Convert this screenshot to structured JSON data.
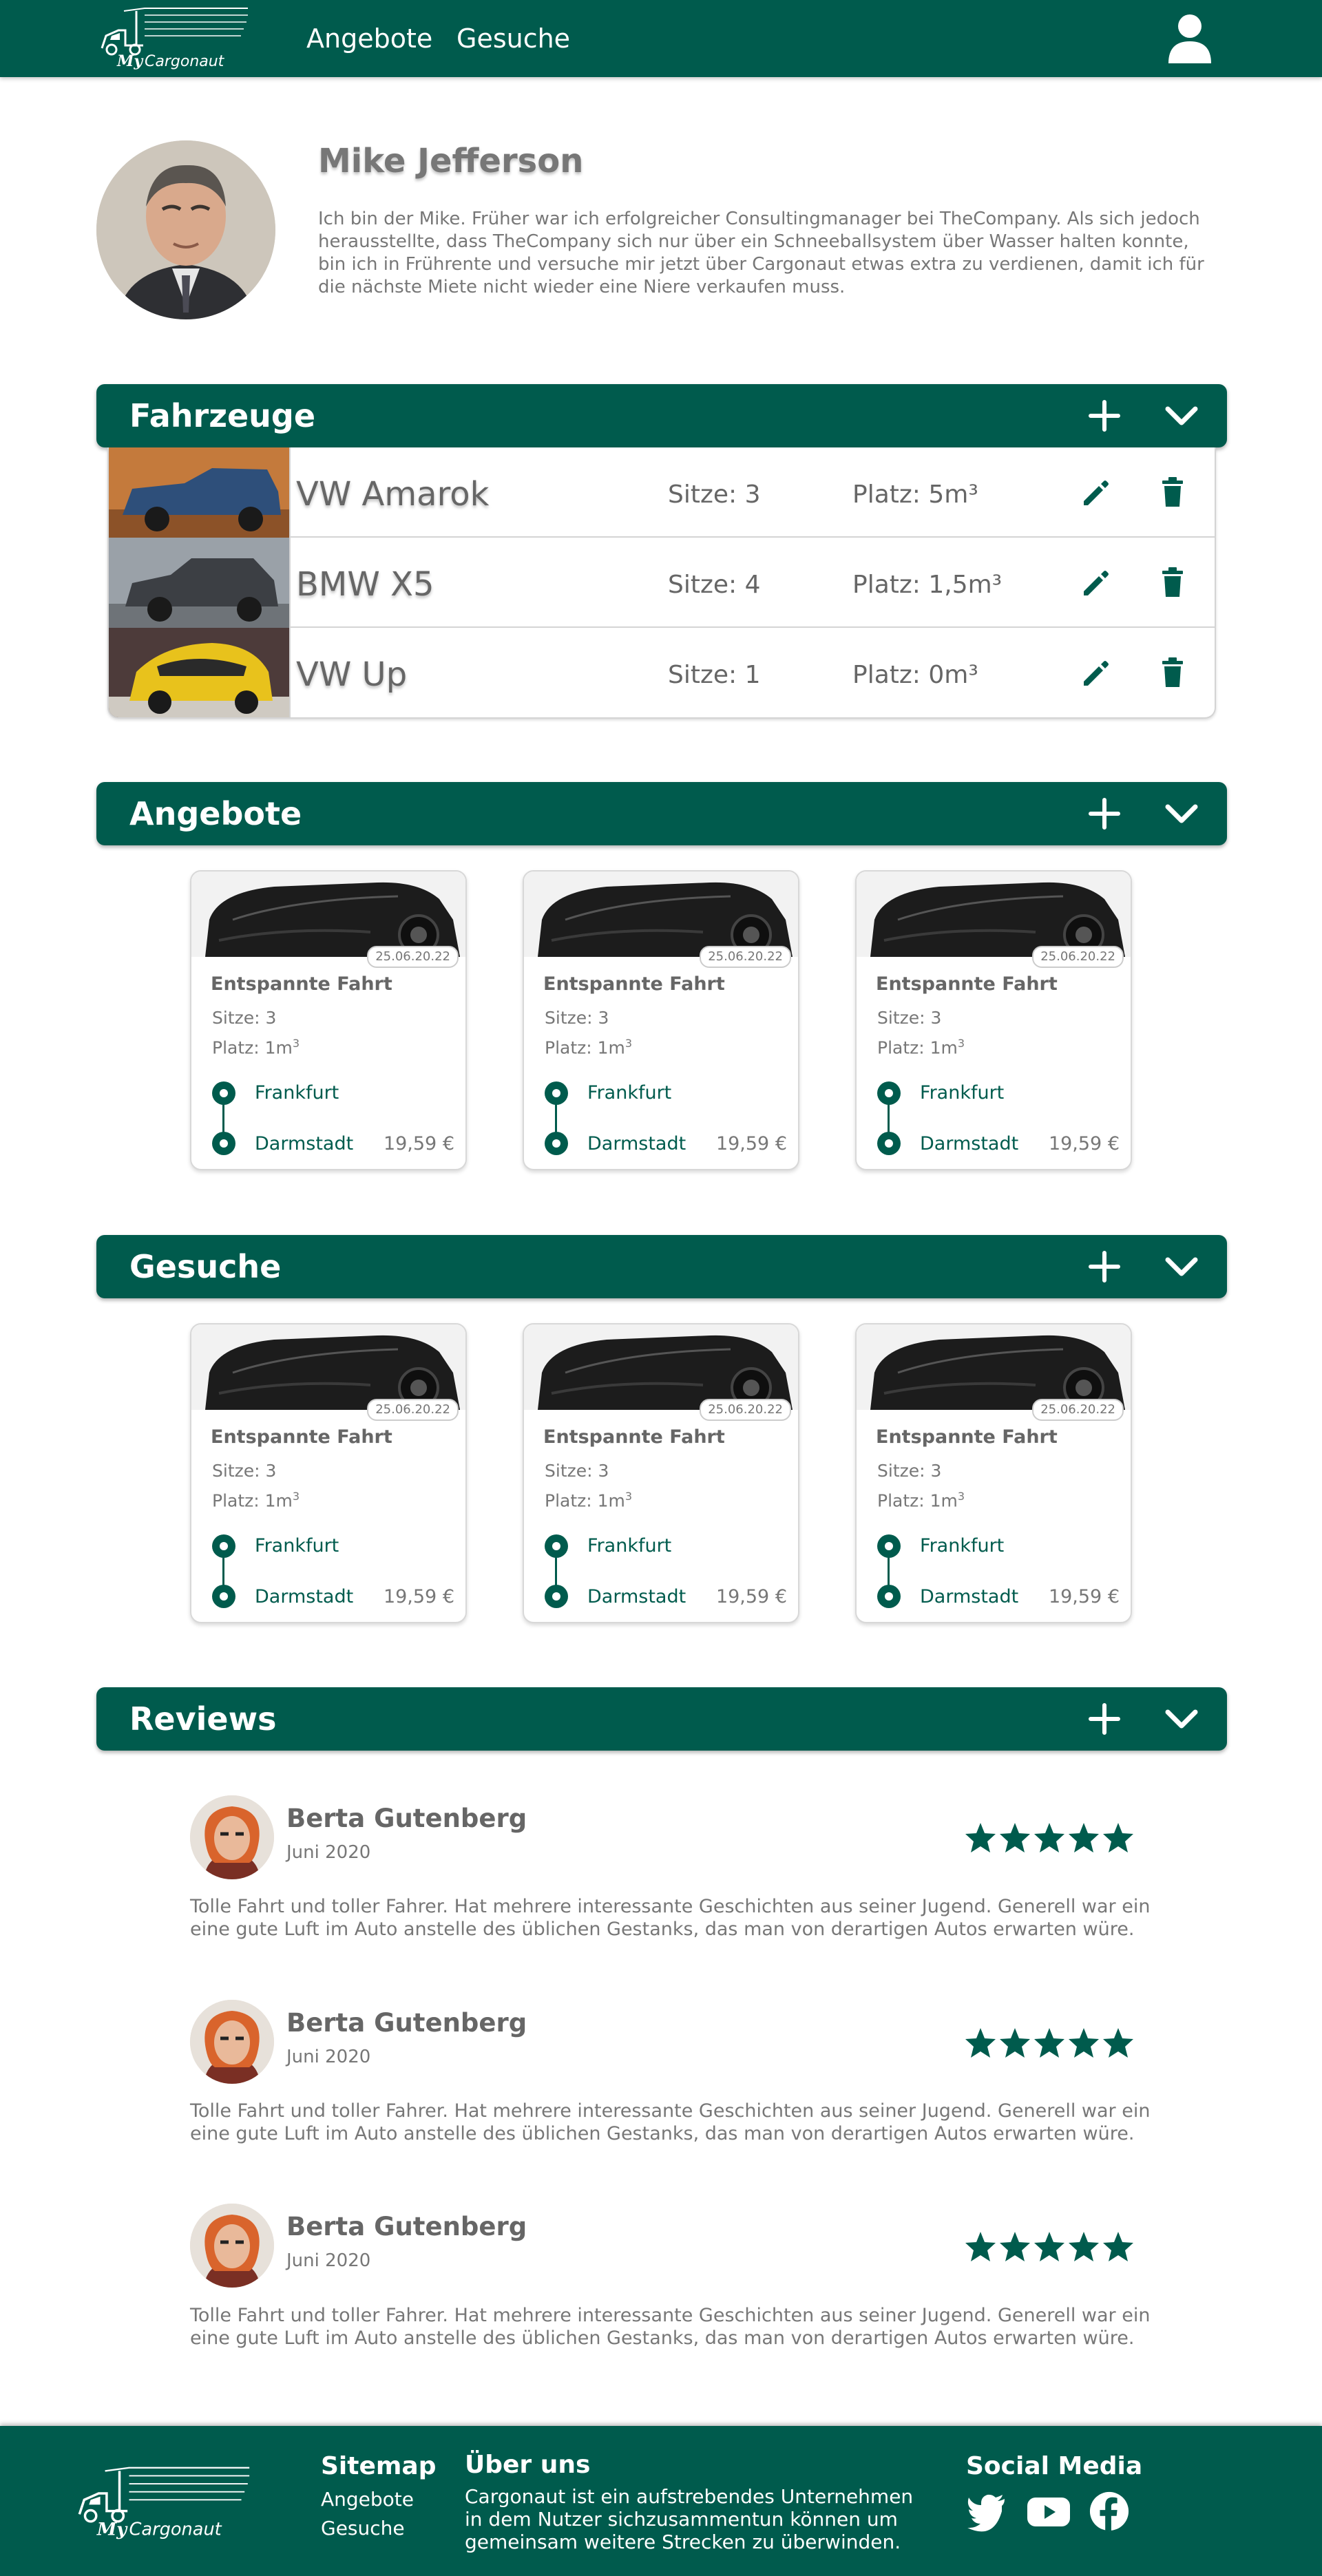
{
  "nav": {
    "logo_word1": "My",
    "logo_word2": "Cargonaut",
    "links": [
      "Angebote",
      "Gesuche"
    ],
    "user_icon": "user-icon"
  },
  "profile": {
    "name": "Mike Jefferson",
    "bio": "Ich bin der Mike. Früher war ich erfolgreicher Consultingmanager bei TheCompany. Als sich jedoch herausstellte, dass TheCompany sich nur über ein Schneeballsystem über Wasser halten konnte, bin ich in Frührente und versuche mir jetzt über Cargonaut etwas extra zu verdienen, damit ich für die nächste Miete nicht wieder eine Niere verkaufen muss."
  },
  "sections": {
    "vehicles": "Fahrzeuge",
    "offers": "Angebote",
    "requests": "Gesuche",
    "reviews": "Reviews"
  },
  "vehicles": [
    {
      "name": "VW Amarok",
      "seats": "Sitze: 3",
      "space": "Platz: 5m³",
      "color": "#2e4f7a"
    },
    {
      "name": "BMW X5",
      "seats": "Sitze: 4",
      "space": "Platz: 1,5m³",
      "color": "#3c3f44"
    },
    {
      "name": "VW Up",
      "seats": "Sitze: 1",
      "space": "Platz: 0m³",
      "color": "#e8c21c"
    }
  ],
  "offers": [
    {
      "date": "25.06.20.22",
      "title": "Entspannte Fahrt",
      "seats": "Sitze: 3",
      "space": "Platz: 1m",
      "space_sup": "3",
      "from": "Frankfurt",
      "to": "Darmstadt",
      "price": "19,59 €"
    },
    {
      "date": "25.06.20.22",
      "title": "Entspannte Fahrt",
      "seats": "Sitze: 3",
      "space": "Platz: 1m",
      "space_sup": "3",
      "from": "Frankfurt",
      "to": "Darmstadt",
      "price": "19,59 €"
    },
    {
      "date": "25.06.20.22",
      "title": "Entspannte Fahrt",
      "seats": "Sitze: 3",
      "space": "Platz: 1m",
      "space_sup": "3",
      "from": "Frankfurt",
      "to": "Darmstadt",
      "price": "19,59 €"
    }
  ],
  "requests": [
    {
      "date": "25.06.20.22",
      "title": "Entspannte Fahrt",
      "seats": "Sitze: 3",
      "space": "Platz: 1m",
      "space_sup": "3",
      "from": "Frankfurt",
      "to": "Darmstadt",
      "price": "19,59 €"
    },
    {
      "date": "25.06.20.22",
      "title": "Entspannte Fahrt",
      "seats": "Sitze: 3",
      "space": "Platz: 1m",
      "space_sup": "3",
      "from": "Frankfurt",
      "to": "Darmstadt",
      "price": "19,59 €"
    },
    {
      "date": "25.06.20.22",
      "title": "Entspannte Fahrt",
      "seats": "Sitze: 3",
      "space": "Platz: 1m",
      "space_sup": "3",
      "from": "Frankfurt",
      "to": "Darmstadt",
      "price": "19,59 €"
    }
  ],
  "reviews": [
    {
      "name": "Berta Gutenberg",
      "date": "Juni 2020",
      "stars": 5,
      "text": "Tolle Fahrt und toller Fahrer. Hat mehrere interessante Geschichten aus seiner Jugend. Generell war ein eine gute Luft im Auto anstelle des üblichen Gestanks, das man von derartigen Autos erwarten würe."
    },
    {
      "name": "Berta Gutenberg",
      "date": "Juni 2020",
      "stars": 5,
      "text": "Tolle Fahrt und toller Fahrer. Hat mehrere interessante Geschichten aus seiner Jugend. Generell war ein eine gute Luft im Auto anstelle des üblichen Gestanks, das man von derartigen Autos erwarten würe."
    },
    {
      "name": "Berta Gutenberg",
      "date": "Juni 2020",
      "stars": 5,
      "text": "Tolle Fahrt und toller Fahrer. Hat mehrere interessante Geschichten aus seiner Jugend. Generell war ein eine gute Luft im Auto anstelle des üblichen Gestanks, das man von derartigen Autos erwarten würe."
    }
  ],
  "footer": {
    "sitemap_title": "Sitemap",
    "sitemap_links": [
      "Angebote",
      "Gesuche"
    ],
    "about_title": "Über uns",
    "about_text": "Cargonaut ist ein aufstrebendes Unternehmen in dem Nutzer sichzusammentun können um gemeinsam weitere Strecken zu überwinden.",
    "social_title": "Social Media",
    "social_icons": [
      "twitter-icon",
      "youtube-icon",
      "facebook-icon"
    ]
  },
  "colors": {
    "brand": "#005b4d",
    "text": "#666666"
  }
}
